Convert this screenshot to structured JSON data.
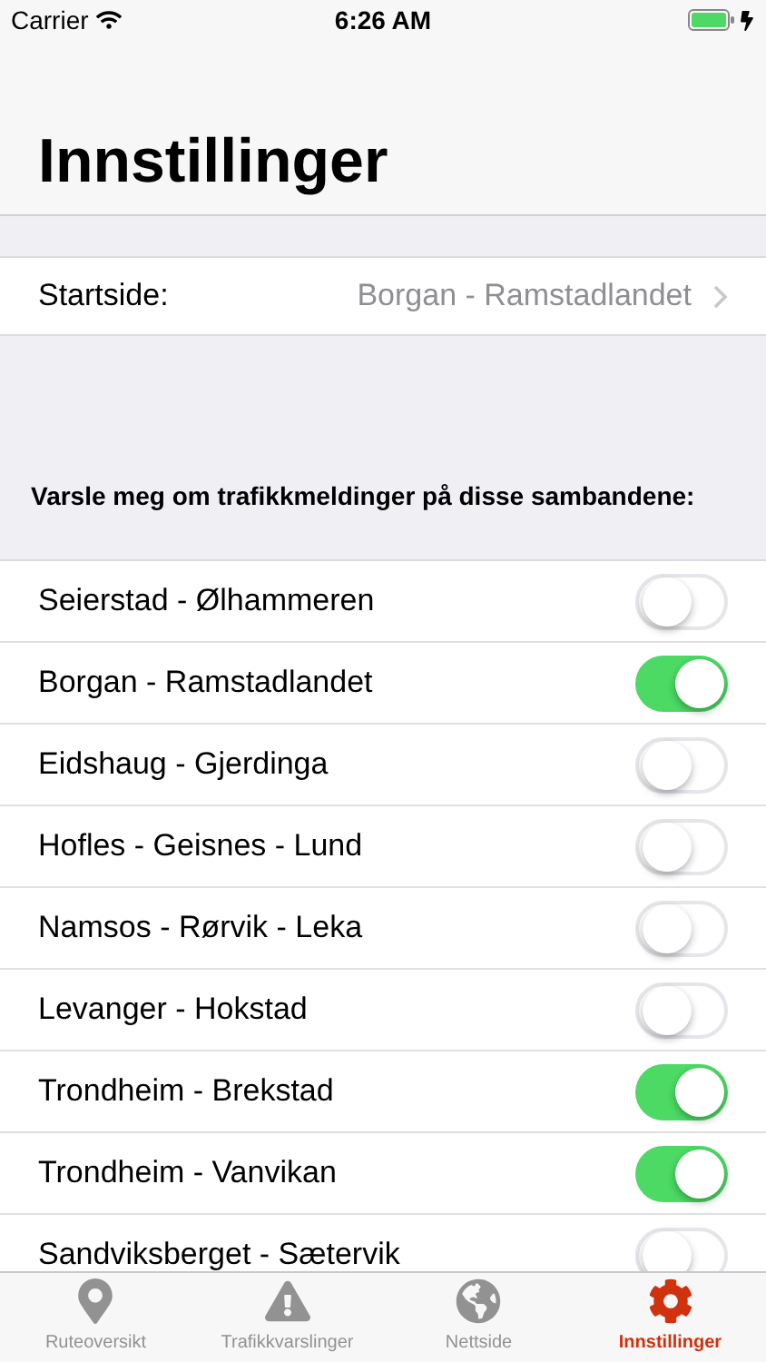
{
  "status_bar": {
    "carrier": "Carrier",
    "time": "6:26 AM"
  },
  "title": "Innstillinger",
  "start_page": {
    "label": "Startside:",
    "value": "Borgan - Ramstadlandet"
  },
  "section_header": "Varsle meg om trafikkmeldinger på disse sambandene:",
  "routes": [
    {
      "name": "Seierstad - Ølhammeren",
      "on": false
    },
    {
      "name": "Borgan - Ramstadlandet",
      "on": true
    },
    {
      "name": "Eidshaug - Gjerdinga",
      "on": false
    },
    {
      "name": "Hofles - Geisnes - Lund",
      "on": false
    },
    {
      "name": "Namsos - Rørvik - Leka",
      "on": false
    },
    {
      "name": "Levanger - Hokstad",
      "on": false
    },
    {
      "name": "Trondheim - Brekstad",
      "on": true
    },
    {
      "name": "Trondheim - Vanvikan",
      "on": true
    },
    {
      "name": "Sandviksberget - Sætervik",
      "on": false
    }
  ],
  "tabs": [
    {
      "label": "Ruteoversikt",
      "kind": "pin",
      "selected": false
    },
    {
      "label": "Trafikkvarslinger",
      "kind": "warning",
      "selected": false
    },
    {
      "label": "Nettside",
      "kind": "globe",
      "selected": false
    },
    {
      "label": "Innstillinger",
      "kind": "gear",
      "selected": true
    }
  ]
}
